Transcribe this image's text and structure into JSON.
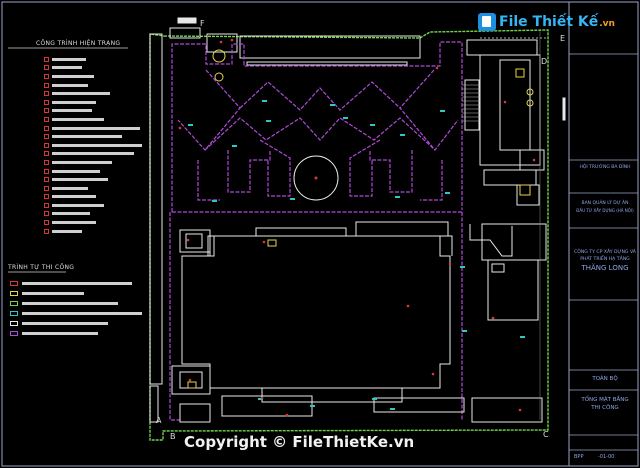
{
  "drawing": {
    "legend_existing_title": "CÔNG TRÌNH HIỆN TRẠNG",
    "legend_construction_title": "TRÌNH TỰ THI CÔNG",
    "corner_labels": [
      "A",
      "B",
      "C",
      "D",
      "E",
      "F"
    ]
  },
  "title_block": {
    "project": "HỘI TRƯỜNG BA ĐÌNH",
    "owner_line1": "BAN QUẢN LÝ DỰ ÁN",
    "owner_line2": "ĐẦU TƯ XÂY DỰNG (HÀ NỘI)",
    "company_line1": "CÔNG TY CP XÂY DỰNG VÀ",
    "company_line2": "PHÁT TRIỂN HẠ TẦNG",
    "company_name": "THĂNG LONG",
    "sheet_scope": "TOÀN BỘ",
    "sheet_title_line1": "TỔNG MẶT BẰNG",
    "sheet_title_line2": "THI CÔNG",
    "sheet_number": "-01-00",
    "sheet_prefix": "BPP"
  },
  "watermark": {
    "logo_text": "File Thiết Kế",
    "logo_suffix": ".vn",
    "copyright": "Copyright © FileThietKe.vn"
  },
  "colors": {
    "site_boundary": "#6fd64b",
    "building": "#e8e8e8",
    "landscape": "#b04ad8",
    "marker": "#2fc6c6",
    "accent": "#d33b3b",
    "title_block_text": "#8fa6e8"
  }
}
